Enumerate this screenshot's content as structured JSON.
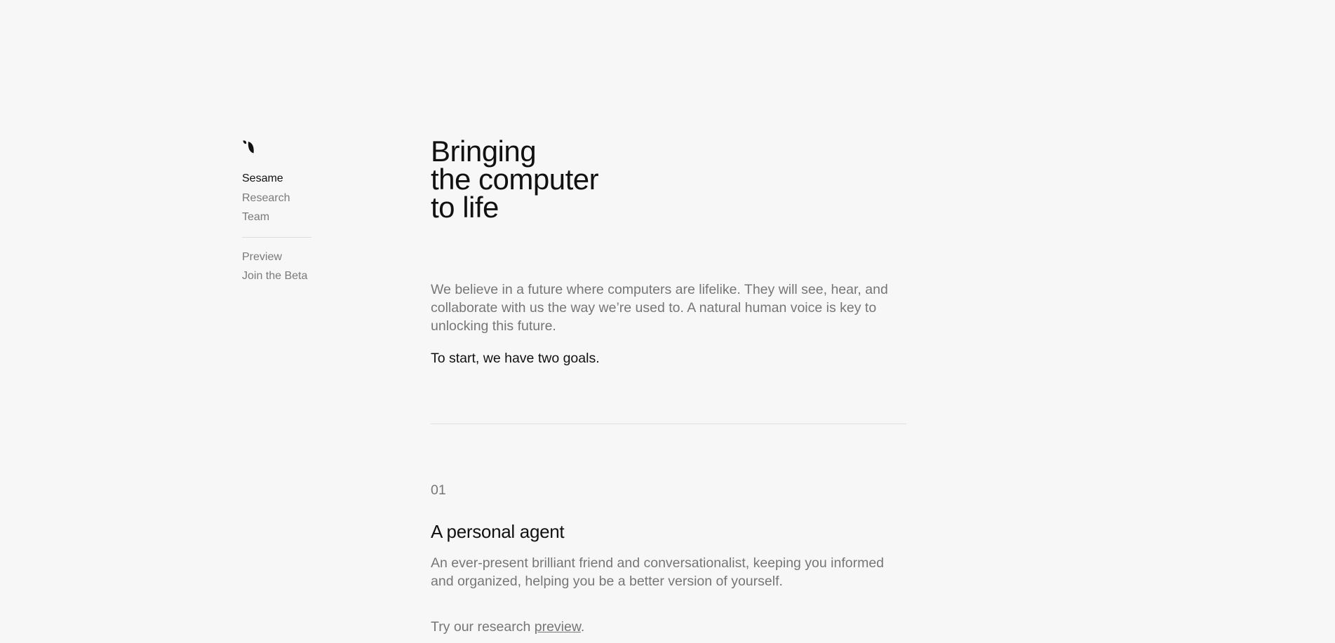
{
  "sidebar": {
    "brand": "Sesame",
    "primary_nav": [
      {
        "label": "Sesame",
        "active": true
      },
      {
        "label": "Research",
        "active": false
      },
      {
        "label": "Team",
        "active": false
      }
    ],
    "secondary_nav": [
      {
        "label": "Preview"
      },
      {
        "label": "Join the Beta"
      }
    ]
  },
  "hero": {
    "headline_lines": [
      "Bringing",
      "the computer",
      "to life"
    ],
    "intro": "We believe in a future where computers are lifelike. They will see, hear, and collaborate with us the way we’re used to. A natural human voice is key to unlocking this future.",
    "lead": "To start, we have two goals."
  },
  "goals": [
    {
      "number": "01",
      "title": "A personal agent",
      "description": "An ever-present brilliant friend and conversationalist, keeping you informed and organized, helping you be a better version of yourself.",
      "cta_prefix": "Try our research ",
      "cta_link": "preview",
      "cta_suffix": "."
    }
  ],
  "colors": {
    "background": "#f7f7f7",
    "text_primary": "#111111",
    "text_secondary": "#767676",
    "divider": "#dedede"
  }
}
